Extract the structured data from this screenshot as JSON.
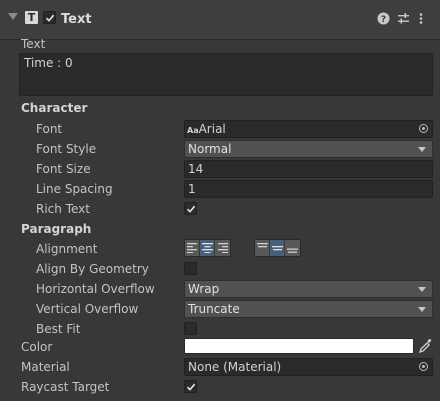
{
  "header": {
    "type_icon": "T",
    "title": "Text",
    "icons": [
      "help-icon",
      "presets-icon",
      "more-icon"
    ]
  },
  "text_section": {
    "label": "Text",
    "value": "Time : 0"
  },
  "character": {
    "heading": "Character",
    "font_label": "Font",
    "font_value": "Arial",
    "font_icon_text": "Aa",
    "font_style_label": "Font Style",
    "font_style_value": "Normal",
    "font_size_label": "Font Size",
    "font_size_value": "14",
    "line_spacing_label": "Line Spacing",
    "line_spacing_value": "1",
    "rich_text_label": "Rich Text",
    "rich_text_checked": true
  },
  "paragraph": {
    "heading": "Paragraph",
    "alignment_label": "Alignment",
    "horizontal_alignment_selected": "center",
    "vertical_alignment_selected": "middle",
    "align_by_geometry_label": "Align By Geometry",
    "align_by_geometry_checked": false,
    "horizontal_overflow_label": "Horizontal Overflow",
    "horizontal_overflow_value": "Wrap",
    "vertical_overflow_label": "Vertical Overflow",
    "vertical_overflow_value": "Truncate",
    "best_fit_label": "Best Fit",
    "best_fit_checked": false
  },
  "color_label": "Color",
  "color_value": "#FFFFFF",
  "material_label": "Material",
  "material_value": "None (Material)",
  "raycast_label": "Raycast Target",
  "raycast_checked": true,
  "colors": {
    "background": "#383838",
    "field": "#2a2a2a",
    "active_button": "#46607c"
  }
}
